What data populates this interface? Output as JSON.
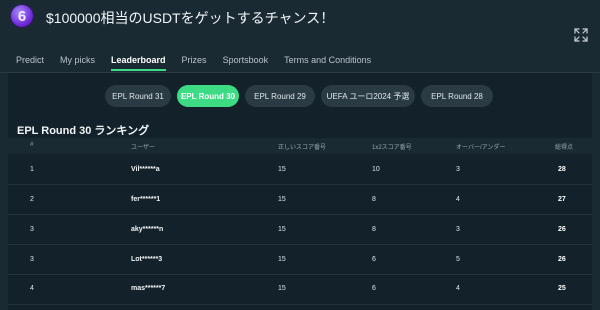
{
  "header": {
    "app_icon_glyph": "6",
    "title": "$100000相当のUSDTをゲットするチャンス！",
    "expand_icon": "expand-icon"
  },
  "tabs": [
    {
      "label": "Predict",
      "active": false
    },
    {
      "label": "My picks",
      "active": false
    },
    {
      "label": "Leaderboard",
      "active": true
    },
    {
      "label": "Prizes",
      "active": false
    },
    {
      "label": "Sportsbook",
      "active": false
    },
    {
      "label": "Terms and Conditions",
      "active": false
    }
  ],
  "rounds": [
    {
      "label": "EPL Round 31",
      "active": false
    },
    {
      "label": "EPL Round 30",
      "active": true
    },
    {
      "label": "EPL Round 29",
      "active": false
    },
    {
      "label": "UEFA ユーロ2024 予選",
      "active": false
    },
    {
      "label": "EPL Round 28",
      "active": false
    }
  ],
  "leaderboard": {
    "title": "EPL Round 30 ランキング",
    "columns": [
      "#",
      "ユーザー",
      "正しいスコア番号",
      "1x2スコア番号",
      "オーバー/アンダー",
      "総得点"
    ],
    "rows": [
      {
        "rank": "1",
        "user": "Vil******a",
        "correct": "15",
        "x12": "10",
        "ou": "3",
        "total": "28"
      },
      {
        "rank": "2",
        "user": "fer******1",
        "correct": "15",
        "x12": "8",
        "ou": "4",
        "total": "27"
      },
      {
        "rank": "3",
        "user": "aky******n",
        "correct": "15",
        "x12": "8",
        "ou": "3",
        "total": "26"
      },
      {
        "rank": "3",
        "user": "Lot******3",
        "correct": "15",
        "x12": "6",
        "ou": "5",
        "total": "26"
      },
      {
        "rank": "4",
        "user": "mas******7",
        "correct": "15",
        "x12": "6",
        "ou": "4",
        "total": "25"
      }
    ]
  },
  "colors": {
    "accent": "#3ddc84",
    "background": "#1a2a33",
    "panel": "#13222a"
  }
}
